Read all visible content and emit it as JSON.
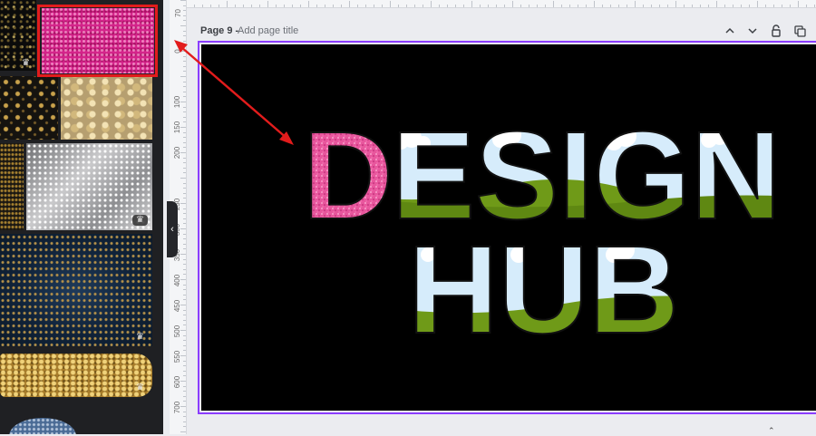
{
  "editor": {
    "page": {
      "label": "Page 9 -",
      "title_placeholder": "Add page title"
    },
    "header_icons": [
      "chevron-up-icon",
      "chevron-down-icon",
      "unlock-icon",
      "duplicate-page-icon"
    ],
    "ruler_left_labels": [
      "0",
      "50",
      "100",
      "150",
      "200",
      "250",
      "300",
      "350",
      "400",
      "450",
      "500",
      "550",
      "600",
      "650",
      "700"
    ],
    "ruler_left_top_label": "70",
    "sidebar_collapse_icon": "chevron-left-icon"
  },
  "sidebar": {
    "thumbnails": [
      {
        "name": "black-gold-sparkle-texture",
        "premium": true
      },
      {
        "name": "pink-glitter-texture",
        "selected": true
      },
      {
        "name": "gold-polka-dot-glitter",
        "premium": false
      },
      {
        "name": "gold-bokeh-glitter",
        "premium": false
      },
      {
        "name": "gold-glitter-edge",
        "premium": false
      },
      {
        "name": "silver-glitter-texture",
        "premium": true
      },
      {
        "name": "navy-gold-dust-background",
        "premium": true
      },
      {
        "name": "gold-glitter-brush-stroke",
        "premium": true
      },
      {
        "name": "blue-glitter-circle",
        "premium": false
      }
    ]
  },
  "canvas": {
    "background": "#000000",
    "headline_line1": "DESIGN",
    "headline_line2": "HUB",
    "first_letter_fill": "pink glitter",
    "other_letters_fill": "sky and green hills"
  },
  "colors": {
    "accent_purple": "#8b3dff",
    "annotation_red": "#e21c1c",
    "glitter_pink": "#e8569d",
    "sky_blue": "#d6ecfb",
    "hill_green": "#6f9a18"
  }
}
